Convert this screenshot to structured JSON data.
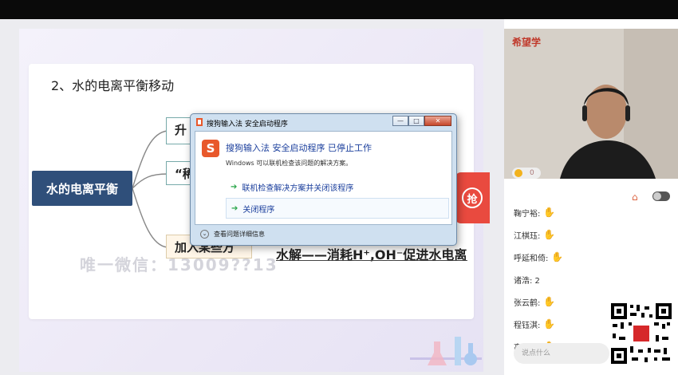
{
  "topbar": {
    "title": ""
  },
  "slide": {
    "section_title": "2、水的电离平衡移动",
    "main_node": "水的电离平衡",
    "branches": [
      "升",
      "“稀",
      "加入某些方"
    ],
    "note": "水解——消耗H⁺,OH⁻促进水电离",
    "watermark": "唯一微信：13009??13",
    "grab_button": "抢"
  },
  "dialog": {
    "title": "搜狗输入法 安全启动程序",
    "logo_letter": "S",
    "heading": "搜狗输入法 安全启动程序 已停止工作",
    "subtext": "Windows 可以联机检查该问题的解决方案。",
    "options": [
      "联机检查解决方案并关闭该程序",
      "关闭程序"
    ],
    "details": "查看问题详细信息",
    "win_buttons": [
      "—",
      "□",
      "✕"
    ]
  },
  "right_panel": {
    "brand": "希望学",
    "coins": "0",
    "home_icon": "home-icon",
    "chat": [
      {
        "name": "鞠宁裕:",
        "hand": true,
        "text": ""
      },
      {
        "name": "江棋珏:",
        "hand": true,
        "text": ""
      },
      {
        "name": "呼延和倚:",
        "hand": true,
        "text": ""
      },
      {
        "name": "诸浩: 2",
        "hand": false,
        "text": ""
      },
      {
        "name": "张云鹤:",
        "hand": true,
        "text": ""
      },
      {
        "name": "程钰淇:",
        "hand": true,
        "text": ""
      },
      {
        "name": "高鑫睿:",
        "hand": true,
        "text": ""
      }
    ],
    "chat_input_placeholder": "说点什么"
  },
  "colors": {
    "accent_red": "#e94a3f",
    "main_node": "#2f4f7a",
    "link_blue": "#1a3e9c"
  }
}
